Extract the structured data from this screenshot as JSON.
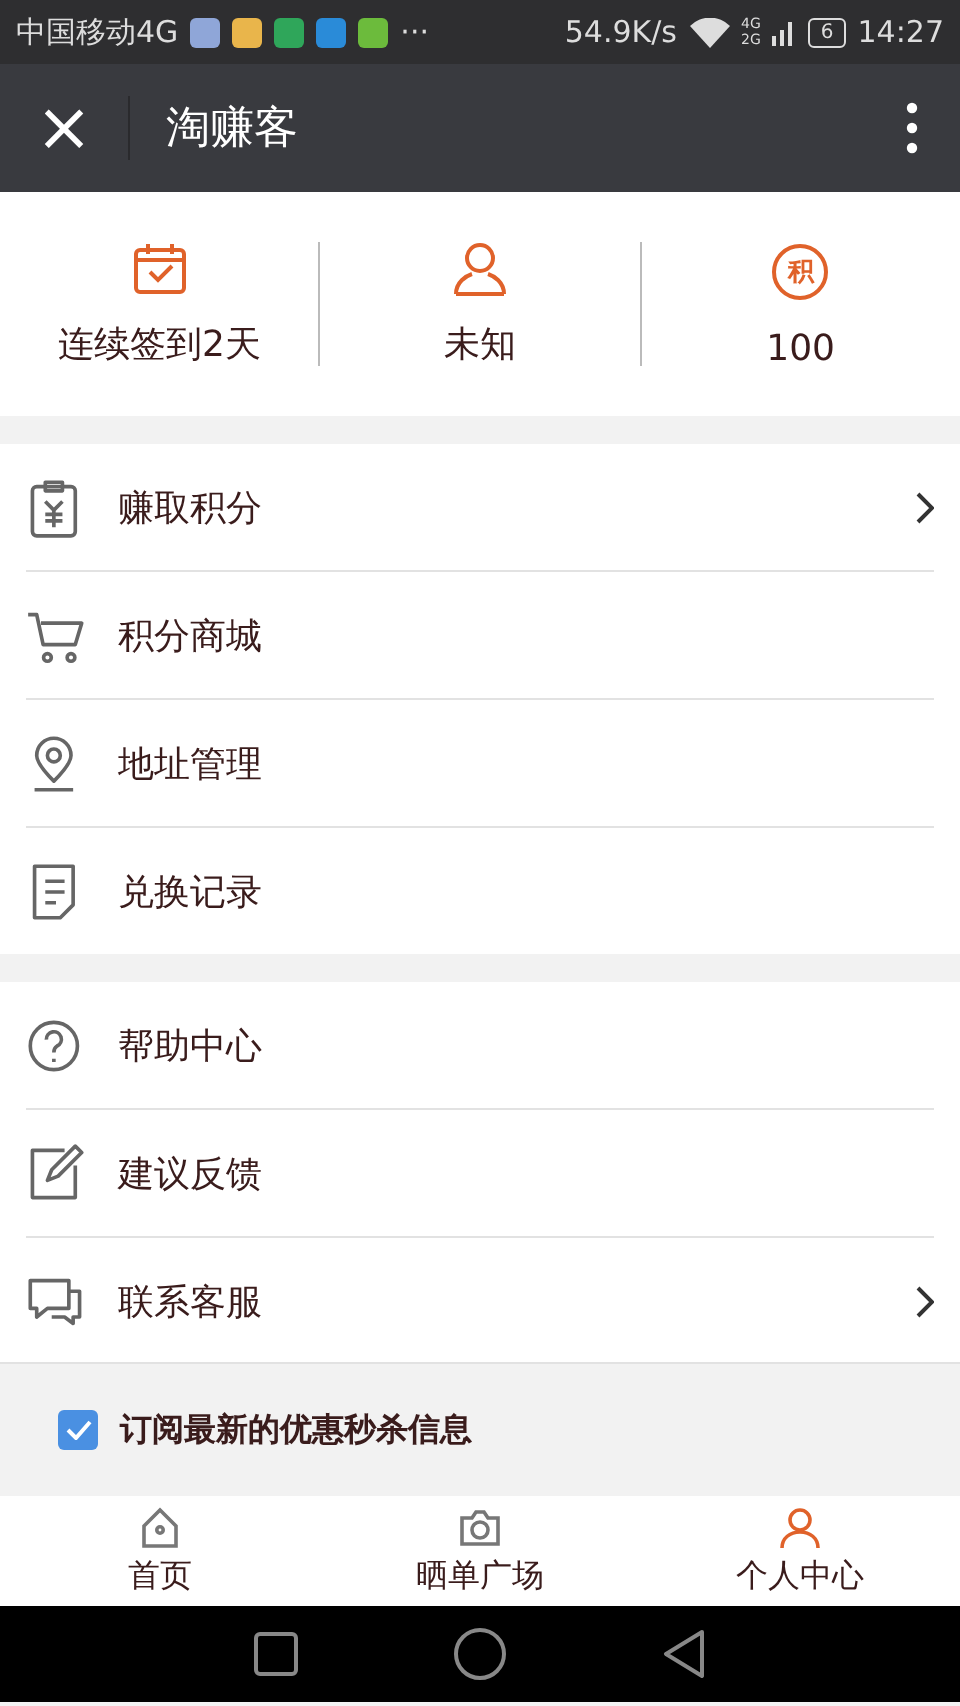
{
  "status_bar": {
    "carrier": "中国移动4G",
    "more": "···",
    "speed": "54.9K/s",
    "net_top": "4G",
    "net_bottom": "2G",
    "battery": "6",
    "time": "14:27"
  },
  "title_bar": {
    "close": "×",
    "title": "淘赚客"
  },
  "stats": [
    {
      "label": "连续签到2天"
    },
    {
      "label": "未知"
    },
    {
      "label": "100",
      "badge": "积"
    }
  ],
  "menu_groups": [
    [
      {
        "label": "赚取积分",
        "chevron": true
      },
      {
        "label": "积分商城",
        "chevron": false
      },
      {
        "label": "地址管理",
        "chevron": false
      },
      {
        "label": "兑换记录",
        "chevron": false
      }
    ],
    [
      {
        "label": "帮助中心",
        "chevron": false
      },
      {
        "label": "建议反馈",
        "chevron": false
      },
      {
        "label": "联系客服",
        "chevron": true
      }
    ]
  ],
  "subscribe": {
    "label": "订阅最新的优惠秒杀信息",
    "checked": true
  },
  "tabs": [
    {
      "label": "首页",
      "selected": false
    },
    {
      "label": "晒单广场",
      "selected": false
    },
    {
      "label": "个人中心",
      "selected": true
    }
  ]
}
